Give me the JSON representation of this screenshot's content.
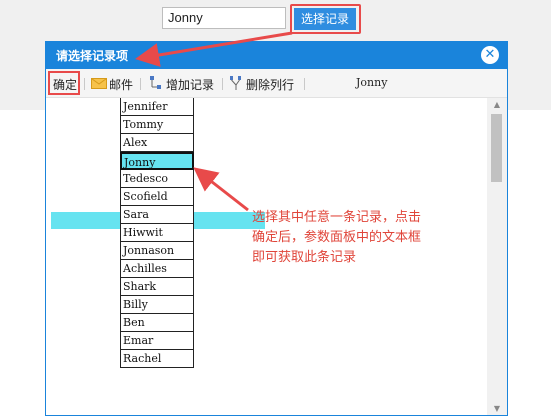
{
  "page": {
    "name_value": "Jonny",
    "select_button_label": "选择记录"
  },
  "dialog": {
    "title": "请选择记录项",
    "close_icon": "close-icon"
  },
  "toolbar": {
    "confirm_label": "确定",
    "mail_label": "邮件",
    "add_label": "增加记录",
    "delete_col_label": "删除列行",
    "current_value": "Jonny"
  },
  "records": [
    "Jennifer",
    "Tommy",
    "Alex",
    "Jonny",
    "Tedesco",
    "Scofield",
    "Sara",
    "Hiwwit",
    "Jonnason",
    "Achilles",
    "Shark",
    "Billy",
    "Ben",
    "Emar",
    "Rachel"
  ],
  "selected_record": "Jonny",
  "annotation": "选择其中任意一条记录，点击确定后，参数面板中的文本框即可获取此条记录",
  "colors": {
    "accent": "#1a84db",
    "highlight": "#e84a4a",
    "selection": "#66e3f0"
  }
}
